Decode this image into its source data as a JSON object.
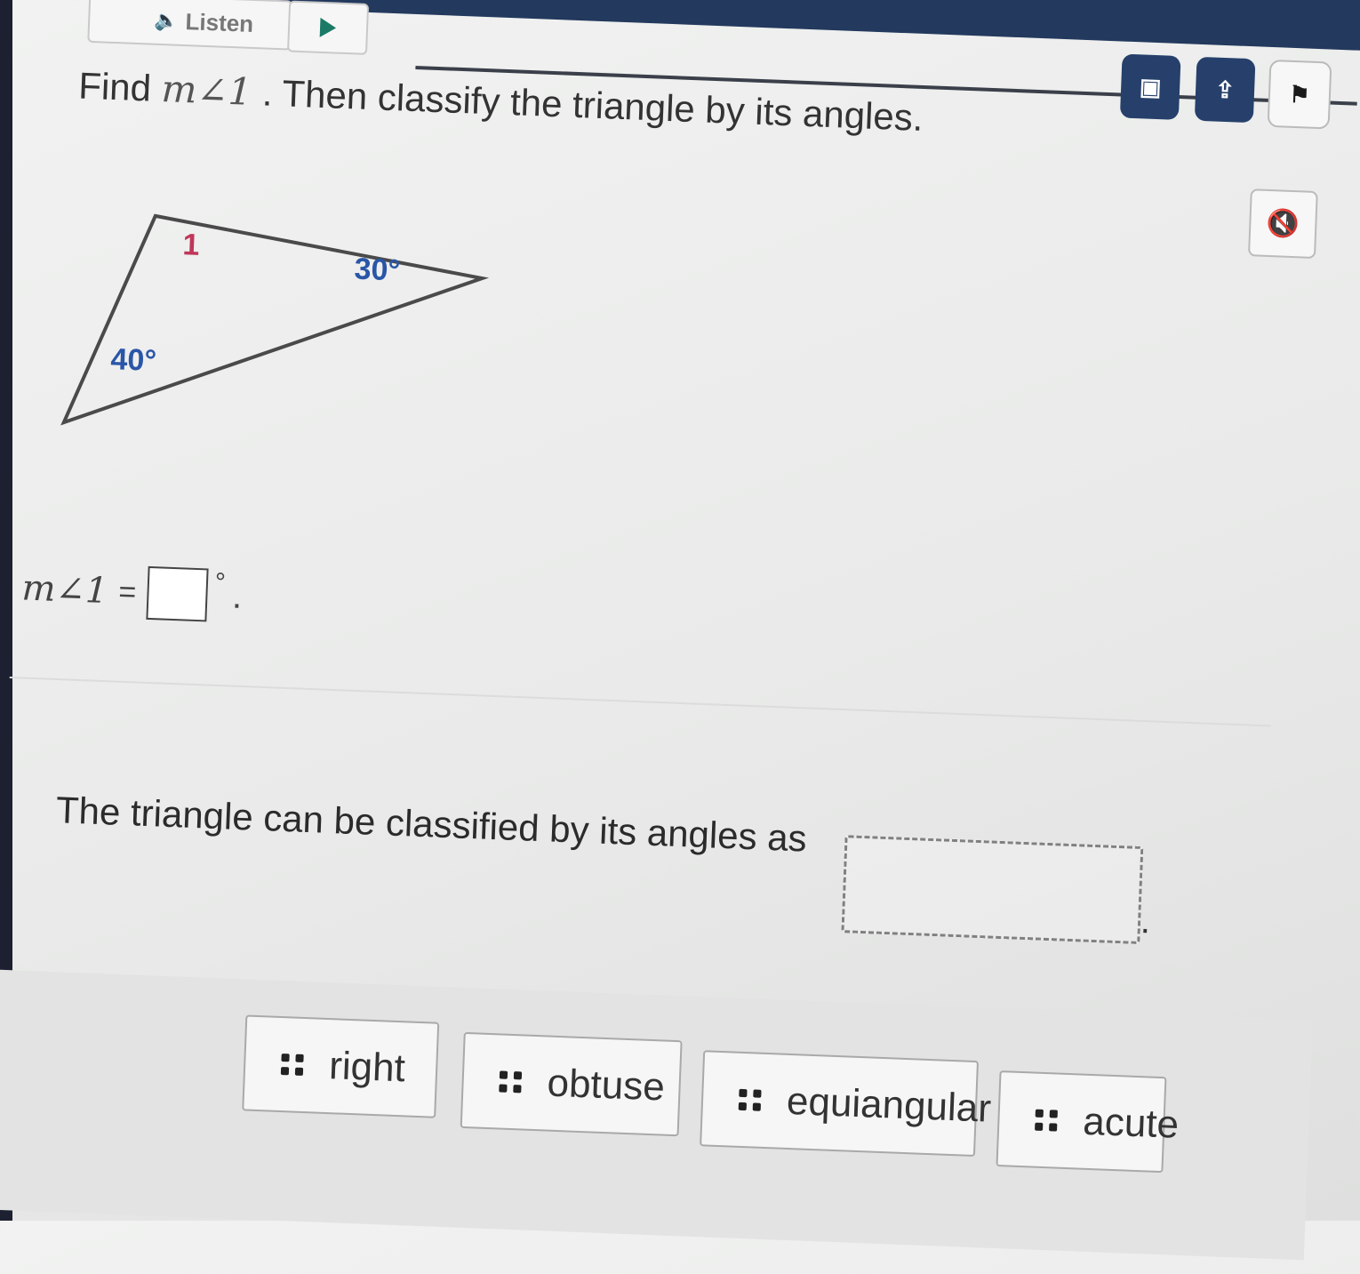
{
  "toolbar": {
    "listen_label": "Listen",
    "tools": [
      {
        "icon": "calculator-icon"
      },
      {
        "icon": "upload-icon"
      },
      {
        "icon": "flag-icon"
      }
    ],
    "mute_icon": "speaker-muted-icon"
  },
  "question": {
    "prompt_prefix": "Find",
    "prompt_var": "m∠1",
    "prompt_suffix": ". Then classify the triangle by its angles.",
    "figure": {
      "angle1_label": "1",
      "angle2_label": "30°",
      "angle3_label": "40°"
    },
    "equation": {
      "lhs": "m∠1",
      "equals": "=",
      "answer_value": "",
      "degree": "°",
      "period": "."
    },
    "classify_text": "The triangle can be classified by its angles as",
    "classify_period": "."
  },
  "choices": [
    {
      "label": "right"
    },
    {
      "label": "obtuse"
    },
    {
      "label": "equiangular"
    },
    {
      "label": "acute"
    }
  ],
  "colors": {
    "toolbar_blue": "#26406b",
    "angle_label_pink": "#c0365a",
    "angle_label_blue": "#2a56a8"
  }
}
